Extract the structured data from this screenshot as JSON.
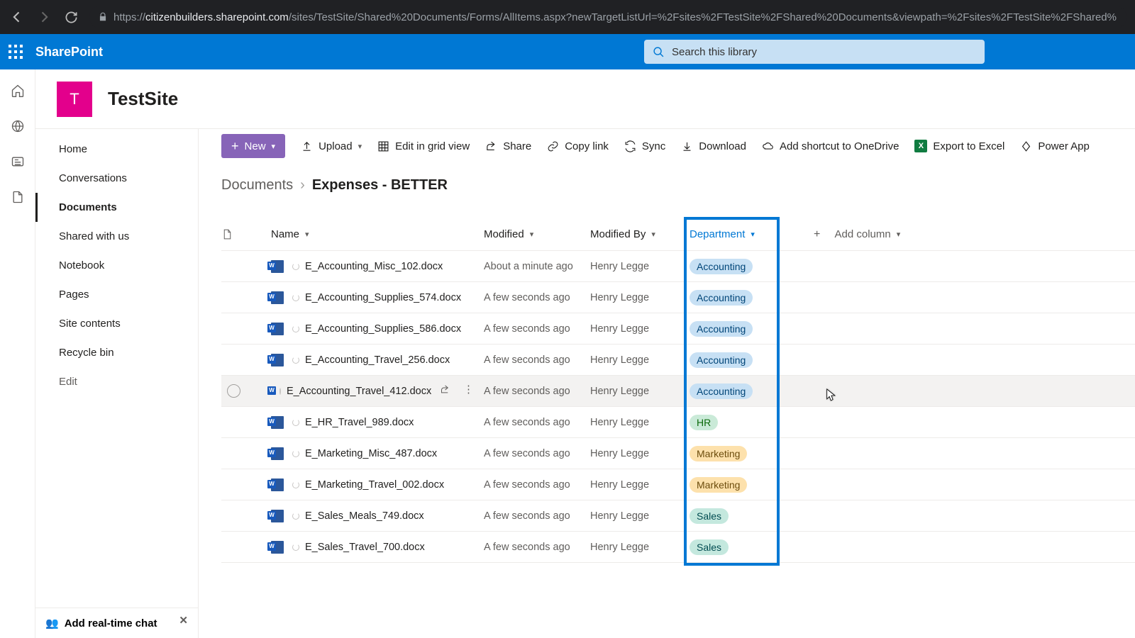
{
  "browser": {
    "url_prefix": "https://",
    "url_domain": "citizenbuilders.sharepoint.com",
    "url_path": "/sites/TestSite/Shared%20Documents/Forms/AllItems.aspx?newTargetListUrl=%2Fsites%2FTestSite%2FShared%20Documents&viewpath=%2Fsites%2FTestSite%2FShared%"
  },
  "sp": {
    "brand": "SharePoint",
    "search_placeholder": "Search this library"
  },
  "site": {
    "logo_letter": "T",
    "title": "TestSite"
  },
  "nav": {
    "items": [
      "Home",
      "Conversations",
      "Documents",
      "Shared with us",
      "Notebook",
      "Pages",
      "Site contents",
      "Recycle bin",
      "Edit"
    ],
    "active_index": 2
  },
  "promo": {
    "text": "Add real-time chat"
  },
  "cmd": {
    "new": "New",
    "upload": "Upload",
    "grid": "Edit in grid view",
    "share": "Share",
    "copy": "Copy link",
    "sync": "Sync",
    "download": "Download",
    "shortcut": "Add shortcut to OneDrive",
    "excel": "Export to Excel",
    "power": "Power App"
  },
  "breadcrumb": {
    "root": "Documents",
    "view": "Expenses - BETTER"
  },
  "columns": {
    "name": "Name",
    "modified": "Modified",
    "by": "Modified By",
    "dept": "Department",
    "add": "Add column"
  },
  "rows": [
    {
      "name": "E_Accounting_Misc_102.docx",
      "mod": "About a minute ago",
      "by": "Henry Legge",
      "dept": "Accounting",
      "cls": "acc"
    },
    {
      "name": "E_Accounting_Supplies_574.docx",
      "mod": "A few seconds ago",
      "by": "Henry Legge",
      "dept": "Accounting",
      "cls": "acc"
    },
    {
      "name": "E_Accounting_Supplies_586.docx",
      "mod": "A few seconds ago",
      "by": "Henry Legge",
      "dept": "Accounting",
      "cls": "acc"
    },
    {
      "name": "E_Accounting_Travel_256.docx",
      "mod": "A few seconds ago",
      "by": "Henry Legge",
      "dept": "Accounting",
      "cls": "acc"
    },
    {
      "name": "E_Accounting_Travel_412.docx",
      "mod": "A few seconds ago",
      "by": "Henry Legge",
      "dept": "Accounting",
      "cls": "acc",
      "hover": true
    },
    {
      "name": "E_HR_Travel_989.docx",
      "mod": "A few seconds ago",
      "by": "Henry Legge",
      "dept": "HR",
      "cls": "hr"
    },
    {
      "name": "E_Marketing_Misc_487.docx",
      "mod": "A few seconds ago",
      "by": "Henry Legge",
      "dept": "Marketing",
      "cls": "mkt"
    },
    {
      "name": "E_Marketing_Travel_002.docx",
      "mod": "A few seconds ago",
      "by": "Henry Legge",
      "dept": "Marketing",
      "cls": "mkt"
    },
    {
      "name": "E_Sales_Meals_749.docx",
      "mod": "A few seconds ago",
      "by": "Henry Legge",
      "dept": "Sales",
      "cls": "sales"
    },
    {
      "name": "E_Sales_Travel_700.docx",
      "mod": "A few seconds ago",
      "by": "Henry Legge",
      "dept": "Sales",
      "cls": "sales"
    }
  ]
}
